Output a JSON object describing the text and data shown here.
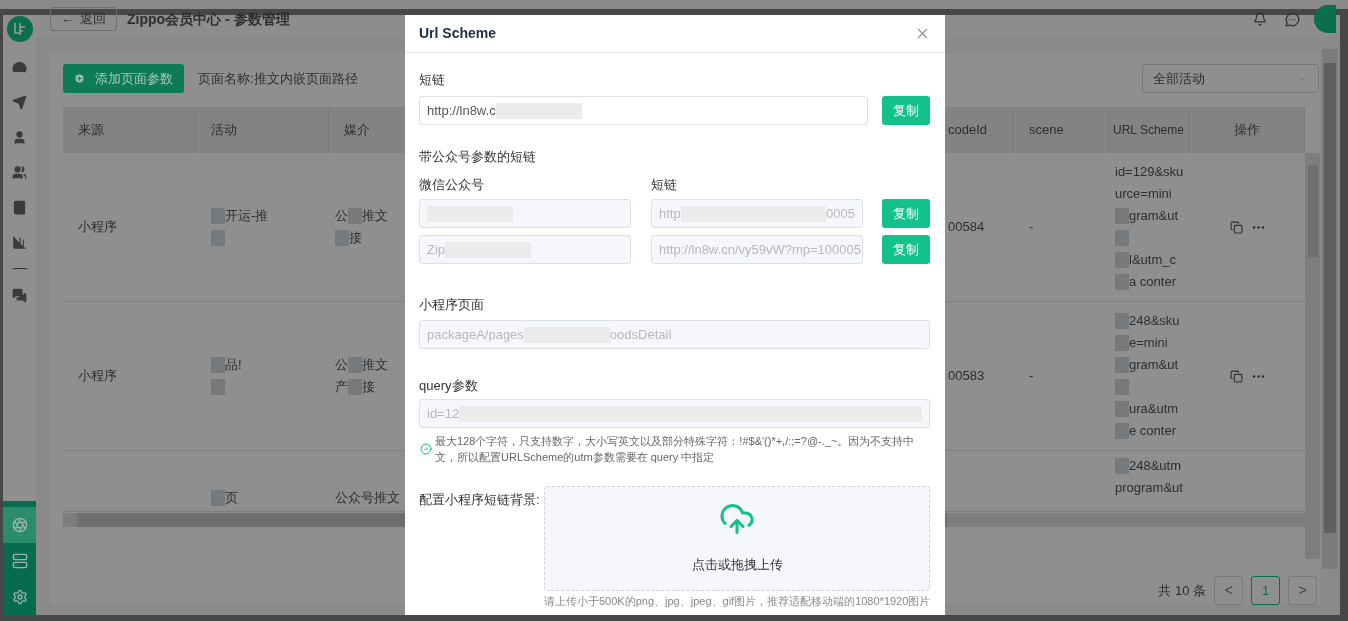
{
  "sidebar": {
    "top_items": [
      {
        "selected": false
      },
      {
        "selected": false
      },
      {
        "selected": false
      },
      {
        "selected": false
      },
      {
        "selected": false
      },
      {
        "selected": false
      },
      {
        "selected": false
      }
    ],
    "bottom_items": [
      {
        "selected": true
      },
      {
        "selected": false
      },
      {
        "selected": false
      }
    ]
  },
  "header": {
    "back": "返回",
    "back_arrow": "←",
    "title": "Zippo会员中心 - 参数管理"
  },
  "toolbar": {
    "add_button": "添加页面参数",
    "page_name": "页面名称:推文内嵌页面路径",
    "activity_select": "全部活动"
  },
  "table": {
    "columns": [
      "来源",
      "活动",
      "媒介",
      "codeId",
      "scene",
      "URL Scheme",
      "操作"
    ],
    "rows": [
      {
        "source": "小程序",
        "activity": [
          [
            {
              "kind": "blur"
            },
            {
              "kind": "text",
              "text": "开运-推"
            }
          ],
          [
            {
              "kind": "blur"
            }
          ]
        ],
        "media": [
          [
            {
              "kind": "text",
              "text": "公"
            },
            {
              "kind": "blur"
            },
            {
              "kind": "text",
              "text": "推文"
            }
          ],
          [
            {
              "kind": "blur"
            },
            {
              "kind": "text",
              "text": "接"
            }
          ]
        ],
        "code_id": "00584",
        "scene": "-",
        "url_scheme": [
          [
            {
              "kind": "text",
              "text": "id=129&sku"
            }
          ],
          [
            {
              "kind": "text",
              "text": "urce=mini"
            }
          ],
          [
            {
              "kind": "blur"
            },
            {
              "kind": "text",
              "text": "gram&ut"
            }
          ],
          [
            {
              "kind": "blur"
            }
          ],
          [
            {
              "kind": "blur"
            },
            {
              "kind": "text",
              "text": "l&utm_c"
            }
          ],
          [
            {
              "kind": "blur"
            },
            {
              "kind": "text",
              "text": "a conter"
            }
          ]
        ]
      },
      {
        "source": "小程序",
        "activity": [
          [
            {
              "kind": "blur"
            },
            {
              "kind": "text",
              "text": "品!"
            }
          ],
          [
            {
              "kind": "blur"
            }
          ]
        ],
        "media": [
          [
            {
              "kind": "text",
              "text": "公"
            },
            {
              "kind": "blur"
            },
            {
              "kind": "text",
              "text": "推文"
            }
          ],
          [
            {
              "kind": "text",
              "text": "产"
            },
            {
              "kind": "blur"
            },
            {
              "kind": "text",
              "text": "接"
            }
          ]
        ],
        "code_id": "00583",
        "scene": "-",
        "url_scheme": [
          [
            {
              "kind": "blur"
            },
            {
              "kind": "text",
              "text": "248&sku"
            }
          ],
          [
            {
              "kind": "blur"
            },
            {
              "kind": "text",
              "text": "e=mini"
            }
          ],
          [
            {
              "kind": "blur"
            },
            {
              "kind": "text",
              "text": "gram&ut"
            }
          ],
          [
            {
              "kind": "blur"
            }
          ],
          [
            {
              "kind": "blur"
            },
            {
              "kind": "text",
              "text": "ura&utm"
            }
          ],
          [
            {
              "kind": "blur"
            },
            {
              "kind": "text",
              "text": "e conter"
            }
          ]
        ]
      },
      {
        "activity": [
          [
            {
              "kind": "blur"
            },
            {
              "kind": "text",
              "text": "页"
            }
          ]
        ],
        "media": [
          [
            {
              "kind": "text",
              "text": "公众号推文"
            }
          ]
        ],
        "url_scheme": [
          [
            {
              "kind": "blur"
            },
            {
              "kind": "text",
              "text": "248&utm"
            }
          ],
          [
            {
              "kind": "text",
              "text": "program&ut"
            }
          ]
        ]
      }
    ]
  },
  "pagination": {
    "total": "共 10 条",
    "prev": "<",
    "next": ">",
    "pages": [
      {
        "label": "1",
        "selected": true
      }
    ]
  },
  "dialog": {
    "title": "Url Scheme",
    "short_link": {
      "label": "短链",
      "value": [
        {
          "kind": "text",
          "text": "http://ln8w.c"
        },
        {
          "kind": "blur"
        }
      ],
      "disabled": false,
      "copy": "复制"
    },
    "mp_links": {
      "label": "带公众号参数的短链",
      "col_account": "微信公众号",
      "col_link": "短链",
      "rows": [
        {
          "account": [
            {
              "kind": "blur"
            }
          ],
          "link": [
            {
              "kind": "text",
              "text": "http"
            },
            {
              "kind": "blur_wide"
            },
            {
              "kind": "text",
              "text": "0005"
            }
          ],
          "disabled": true,
          "copy": "复制"
        },
        {
          "account": [
            {
              "kind": "text",
              "text": "Zip"
            },
            {
              "kind": "blur"
            }
          ],
          "link": [
            {
              "kind": "text",
              "text": "http://ln8w.cn/vy59vW?mp=100005"
            }
          ],
          "disabled": true,
          "copy": "复制"
        }
      ]
    },
    "page": {
      "label": "小程序页面",
      "value": [
        {
          "kind": "text",
          "text": "packageA/pages"
        },
        {
          "kind": "blur"
        },
        {
          "kind": "text",
          "text": "oodsDetail"
        }
      ],
      "disabled": true
    },
    "query": {
      "label": "query参数",
      "value": [
        {
          "kind": "text",
          "text": "id=12"
        },
        {
          "kind": "blur_wide"
        }
      ],
      "disabled": true,
      "hint": "最大128个字符，只支持数字，大小写英文以及部分特殊字符：!#$&'()*+,/:;=?@-._~。因为不支持中文，所以配置URLScheme的utm参数需要在 query 中指定"
    },
    "background": {
      "label": "配置小程序短链背景:",
      "upload_text": "点击或拖拽上传",
      "tip": "请上传小于500K的png、jpg、jpeg、gif图片，推荐适配移动端的1080*1920图片"
    }
  }
}
